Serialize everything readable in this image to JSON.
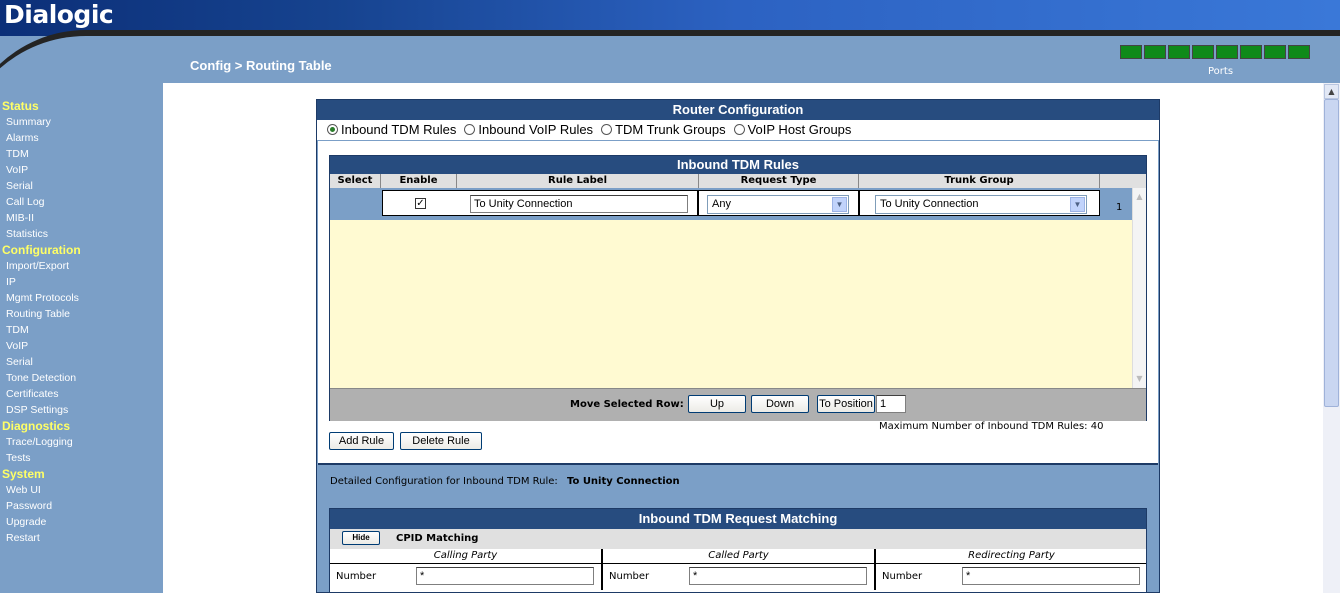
{
  "header": {
    "logo": "Dialogic",
    "breadcrumb": "Config > Routing Table",
    "ports_label": "Ports",
    "ports_color": "#0f8a1a",
    "port_count": 8
  },
  "sidebar": {
    "sections": [
      {
        "title": "Status",
        "items": [
          "Summary",
          "Alarms",
          "TDM",
          "VoIP",
          "Serial",
          "Call Log",
          "MIB-II",
          "Statistics"
        ]
      },
      {
        "title": "Configuration",
        "items": [
          "Import/Export",
          "IP",
          "Mgmt Protocols",
          "Routing Table",
          "TDM",
          "VoIP",
          "Serial",
          "Tone Detection",
          "Certificates",
          "DSP Settings"
        ]
      },
      {
        "title": "Diagnostics",
        "items": [
          "Trace/Logging",
          "Tests"
        ]
      },
      {
        "title": "System",
        "items": [
          "Web UI",
          "Password",
          "Upgrade",
          "Restart"
        ]
      }
    ]
  },
  "router": {
    "title": "Router Configuration",
    "options": [
      "Inbound TDM Rules",
      "Inbound VoIP Rules",
      "TDM Trunk Groups",
      "VoIP Host Groups"
    ],
    "selected": 0
  },
  "rules": {
    "title": "Inbound TDM Rules",
    "columns": [
      "Select",
      "Enable",
      "Rule Label",
      "Request Type",
      "Trunk Group"
    ],
    "row": {
      "enabled": true,
      "check_mark": "✓",
      "label": "To Unity Connection",
      "request_type": "Any",
      "trunk_group": "To Unity Connection",
      "count": "1"
    },
    "move_label": "Move Selected Row:",
    "up": "Up",
    "down": "Down",
    "to_position": "To Position",
    "position_value": "1",
    "max_text": "Maximum Number of Inbound TDM Rules: 40",
    "add": "Add Rule",
    "delete": "Delete Rule"
  },
  "detail": {
    "label": "Detailed Configuration for Inbound TDM Rule:",
    "rule_name": "To Unity Connection"
  },
  "matching": {
    "title": "Inbound TDM Request Matching",
    "hide_button": "Hide",
    "cpid_label": "CPID Matching",
    "parties": [
      "Calling Party",
      "Called Party",
      "Redirecting Party"
    ],
    "number_label": "Number",
    "number_values": [
      "*",
      "*",
      "*"
    ]
  }
}
